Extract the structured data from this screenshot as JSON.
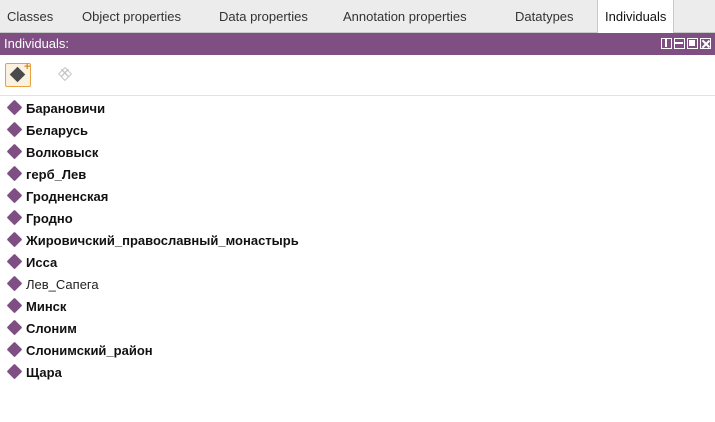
{
  "tabs": [
    {
      "label": "Classes",
      "active": false
    },
    {
      "label": "Object properties",
      "active": false
    },
    {
      "label": "Data properties",
      "active": false
    },
    {
      "label": "Annotation properties",
      "active": false
    },
    {
      "label": "Datatypes",
      "active": false
    },
    {
      "label": "Individuals",
      "active": true
    }
  ],
  "view": {
    "title": "Individuals:",
    "header_color": "#7f4f84",
    "controls": [
      "split-view-icon",
      "horizontal-split-icon",
      "float-view-icon",
      "close-view-icon"
    ]
  },
  "toolbar": {
    "add_individual_icon": "add-individual-icon",
    "delete_individual_icon": "delete-individual-icon"
  },
  "individuals": [
    {
      "label": "Барановичи",
      "bold": true
    },
    {
      "label": "Беларусь",
      "bold": true
    },
    {
      "label": "Волковыск",
      "bold": true
    },
    {
      "label": "герб_Лев",
      "bold": true
    },
    {
      "label": "Гродненская",
      "bold": true
    },
    {
      "label": "Гродно",
      "bold": true
    },
    {
      "label": "Жировичский_православный_монастырь",
      "bold": true
    },
    {
      "label": "Исса",
      "bold": true
    },
    {
      "label": "Лев_Сапега",
      "bold": false
    },
    {
      "label": "Минск",
      "bold": true
    },
    {
      "label": "Слоним",
      "bold": true
    },
    {
      "label": "Слонимский_район",
      "bold": true
    },
    {
      "label": "Щара",
      "bold": true
    }
  ],
  "colors": {
    "individual_bullet": "#7f4f84",
    "tab_bar": "#ececec"
  }
}
